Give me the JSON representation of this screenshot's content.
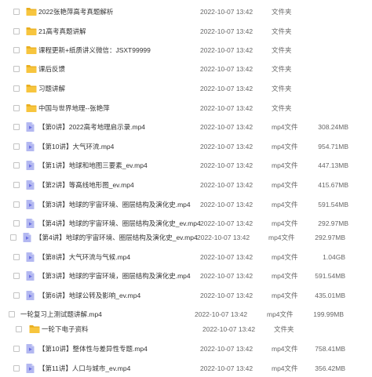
{
  "colors": {
    "folder": "#F7C53E",
    "folder_dark": "#E9AE1F",
    "video_body": "#B3B8F1",
    "video_accent": "#6A6FE0",
    "checkbox_border": "#C4C4C4",
    "text": "#333333",
    "muted": "#666666"
  },
  "files": [
    {
      "name": "2022张艳萍高考真题解析",
      "date": "2022-10-07 13:42",
      "type": "文件夹",
      "size": "",
      "icon": "folder-icon"
    },
    {
      "name": "21高考真题讲解",
      "date": "2022-10-07 13:42",
      "type": "文件夹",
      "size": "",
      "icon": "folder-icon"
    },
    {
      "name": "课程更新+纸质讲义微信：JSXT99999",
      "date": "2022-10-07 13:42",
      "type": "文件夹",
      "size": "",
      "icon": "folder-icon"
    },
    {
      "name": "课后反馈",
      "date": "2022-10-07 13:42",
      "type": "文件夹",
      "size": "",
      "icon": "folder-icon"
    },
    {
      "name": "习题讲解",
      "date": "2022-10-07 13:42",
      "type": "文件夹",
      "size": "",
      "icon": "folder-icon"
    },
    {
      "name": "中国与世界地理--张艳萍",
      "date": "2022-10-07 13:42",
      "type": "文件夹",
      "size": "",
      "icon": "folder-icon"
    },
    {
      "name": "【第0讲】2022高考地理启示录.mp4",
      "date": "2022-10-07 13:42",
      "type": "mp4文件",
      "size": "308.24MB",
      "icon": "video-file-icon"
    },
    {
      "name": "【第10讲】大气环流.mp4",
      "date": "2022-10-07 13:42",
      "type": "mp4文件",
      "size": "954.71MB",
      "icon": "video-file-icon"
    },
    {
      "name": "【第1讲】地球和地图三要素_ev.mp4",
      "date": "2022-10-07 13:42",
      "type": "mp4文件",
      "size": "447.13MB",
      "icon": "video-file-icon"
    },
    {
      "name": "【第2讲】等高线地形图_ev.mp4",
      "date": "2022-10-07 13:42",
      "type": "mp4文件",
      "size": "415.67MB",
      "icon": "video-file-icon"
    },
    {
      "name": "【第3讲】地球的宇宙环境、圈层结构及演化史.mp4",
      "date": "2022-10-07 13:42",
      "type": "mp4文件",
      "size": "591.54MB",
      "icon": "video-file-icon"
    },
    {
      "name": "【第4讲】地球的宇宙环境、圈层结构及演化史_ev.mp4",
      "date": "2022-10-07 13:42",
      "type": "mp4文件",
      "size": "292.97MB",
      "icon": "video-file-icon"
    },
    {
      "name": "【第4讲】地球的宇宙环境、圈层结构及演化史_ev.mp4",
      "date": "2022-10-07 13:42",
      "type": "mp4文件",
      "size": "292.97MB",
      "icon": "video-file-icon"
    },
    {
      "name": "【第8讲】大气环流与气候.mp4",
      "date": "2022-10-07 13:42",
      "type": "mp4文件",
      "size": "1.04GB",
      "icon": "video-file-icon"
    },
    {
      "name": "【第3讲】地球的宇宙环境，圈层结构及演化史.mp4",
      "date": "2022-10-07 13:42",
      "type": "mp4文件",
      "size": "591.54MB",
      "icon": "video-file-icon"
    },
    {
      "name": "【第6讲】地球公转及影响_ev.mp4",
      "date": "2022-10-07 13:42",
      "type": "mp4文件",
      "size": "435.01MB",
      "icon": "video-file-icon"
    },
    {
      "name": "一轮复习上测试题讲解.mp4",
      "date": "2022-10-07 13:42",
      "type": "mp4文件",
      "size": "199.99MB",
      "icon": "video-file-icon"
    },
    {
      "name": "一轮下电子资料",
      "date": "2022-10-07 13:42",
      "type": "文件夹",
      "size": "",
      "icon": "folder-icon"
    },
    {
      "name": "【第10讲】整体性与差异性专题.mp4",
      "date": "2022-10-07 13:42",
      "type": "mp4文件",
      "size": "758.41MB",
      "icon": "video-file-icon"
    },
    {
      "name": "【第11讲】人口与城市_ev.mp4",
      "date": "2022-10-07 13:42",
      "type": "mp4文件",
      "size": "356.42MB",
      "icon": "video-file-icon"
    }
  ]
}
